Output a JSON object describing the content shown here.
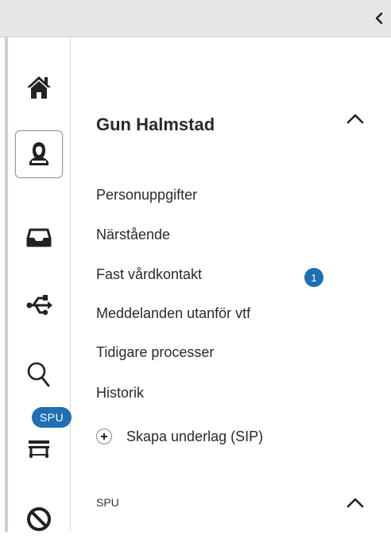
{
  "topbar": {
    "collapse_icon": "chevron-left-icon"
  },
  "rail": {
    "items": [
      {
        "icon": "home-icon"
      },
      {
        "icon": "patient-icon",
        "active": true
      },
      {
        "icon": "inbox-icon"
      },
      {
        "icon": "usb-icon"
      },
      {
        "icon": "search-icon"
      },
      {
        "icon": "cart-icon",
        "badge": "SPU"
      },
      {
        "icon": "block-icon"
      }
    ]
  },
  "patient": {
    "name": "Gun Halmstad"
  },
  "menu": {
    "items": [
      {
        "label": "Personuppgifter"
      },
      {
        "label": "Närstående"
      },
      {
        "label": "Fast vårdkontakt",
        "badge": "1"
      },
      {
        "label": "Meddelanden utanför vtf"
      },
      {
        "label": "Tidigare processer"
      },
      {
        "label": "Historik"
      }
    ],
    "add_label": "Skapa underlag (SIP)"
  },
  "spu_section": {
    "label": "SPU"
  },
  "colors": {
    "accent": "#1f6fb2",
    "icon_dark": "#222222",
    "topbar_bg": "#e6e6e6"
  }
}
